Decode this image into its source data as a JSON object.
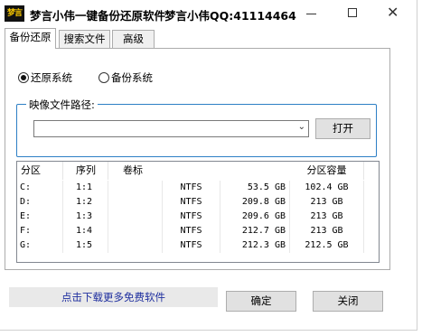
{
  "window": {
    "icon_text": "梦言",
    "title": "梦言小伟一键备份还原软件",
    "qq": "梦言小伟QQ:41114464"
  },
  "controls": {
    "minimize": "minimize",
    "maximize": "maximize",
    "close": "✕"
  },
  "tabs": [
    {
      "label": "备份还原",
      "active": true
    },
    {
      "label": "搜索文件",
      "active": false
    },
    {
      "label": "高级",
      "active": false
    }
  ],
  "mode": {
    "options": [
      {
        "label": "还原系统",
        "selected": true
      },
      {
        "label": "备份系统",
        "selected": false
      }
    ]
  },
  "image_path": {
    "legend": "映像文件路径:",
    "value": "",
    "open_button": "打开"
  },
  "table": {
    "headers": [
      "分区",
      "序列",
      "卷标",
      "",
      "",
      "分区容量"
    ],
    "rows": [
      [
        "C:",
        "1:1",
        "",
        "NTFS",
        "53.5 GB",
        "102.4 GB"
      ],
      [
        "D:",
        "1:2",
        "",
        "NTFS",
        "209.8 GB",
        "213 GB"
      ],
      [
        "E:",
        "1:3",
        "",
        "NTFS",
        "209.6 GB",
        "213 GB"
      ],
      [
        "F:",
        "1:4",
        "",
        "NTFS",
        "212.7 GB",
        "213 GB"
      ],
      [
        "G:",
        "1:5",
        "",
        "NTFS",
        "212.3 GB",
        "212.5 GB"
      ]
    ]
  },
  "footer": {
    "download_link": "点击下载更多免费软件",
    "ok_button": "确定",
    "close_button": "关闭"
  }
}
